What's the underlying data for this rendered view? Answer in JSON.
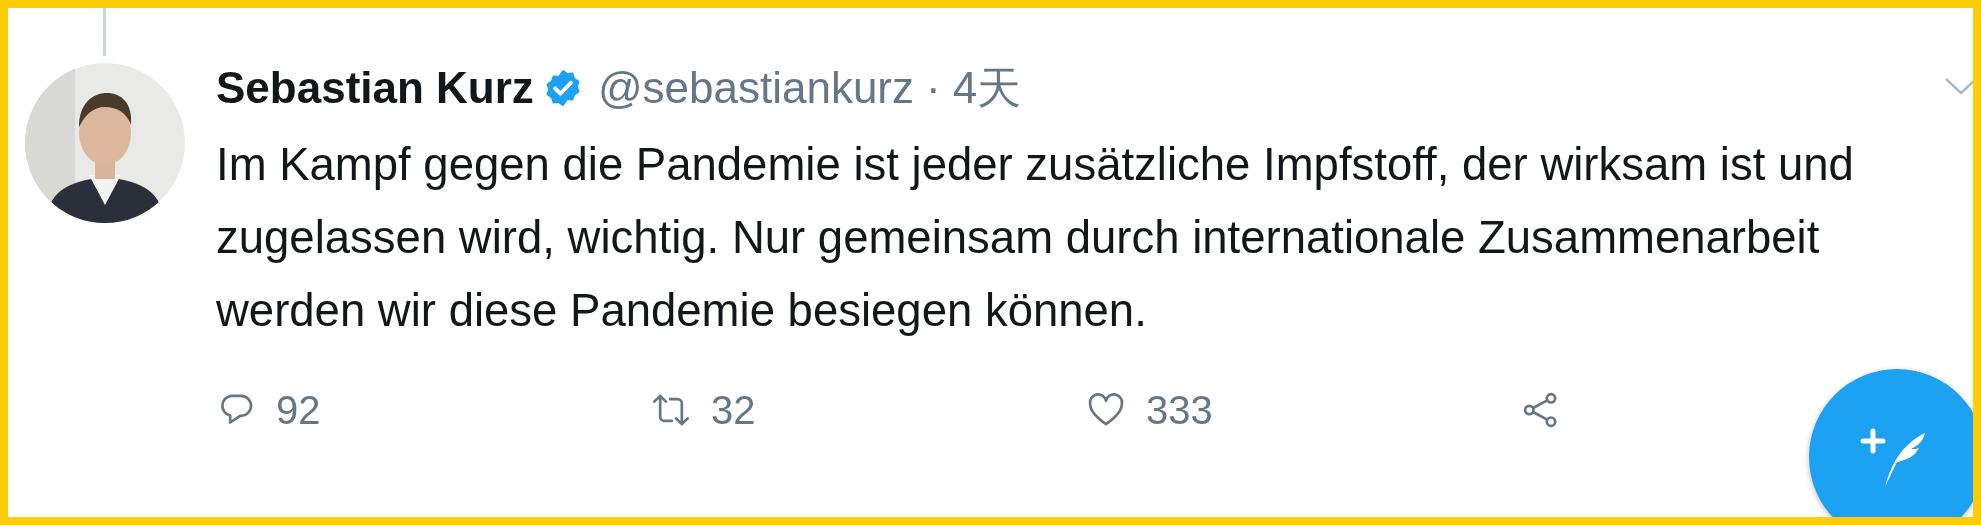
{
  "tweet": {
    "author": {
      "name": "Sebastian Kurz",
      "verified": true,
      "handle": "@sebastiankurz",
      "separator": "·",
      "time": "4天"
    },
    "text": "Im Kampf gegen die Pandemie ist jeder zusätzliche Impfstoff, der wirksam ist und zugelassen wird, wichtig. Nur gemeinsam durch internationale Zusammenarbeit werden wir diese Pandemie besiegen können.",
    "actions": [
      {
        "kind": "reply",
        "count": "92"
      },
      {
        "kind": "retweet",
        "count": "32"
      },
      {
        "kind": "like",
        "count": "333"
      },
      {
        "kind": "share"
      }
    ]
  }
}
